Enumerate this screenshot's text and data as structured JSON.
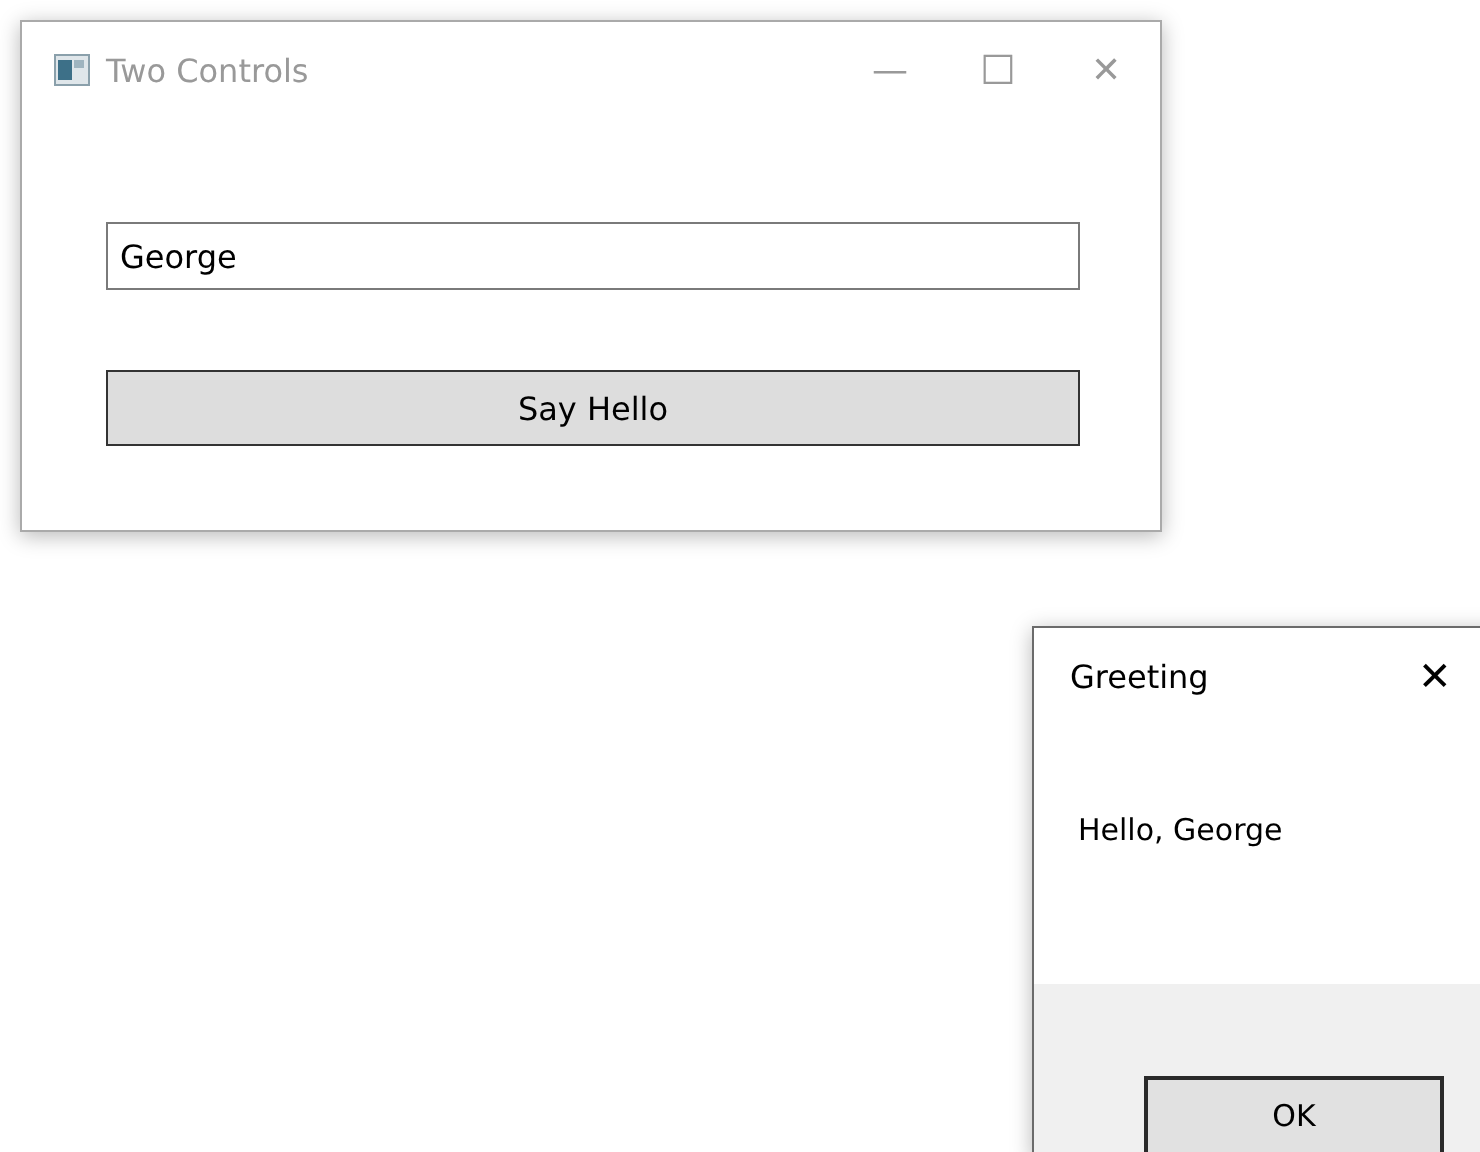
{
  "main_window": {
    "title": "Two Controls",
    "active": false,
    "controls": [
      "—",
      "☐",
      "✕"
    ],
    "name_field": {
      "value": "George"
    },
    "button": {
      "label": "Say Hello"
    }
  },
  "dialog": {
    "title": "Greeting",
    "active": true,
    "close": "✕",
    "message": "Hello, George",
    "button": {
      "label": "OK"
    }
  }
}
